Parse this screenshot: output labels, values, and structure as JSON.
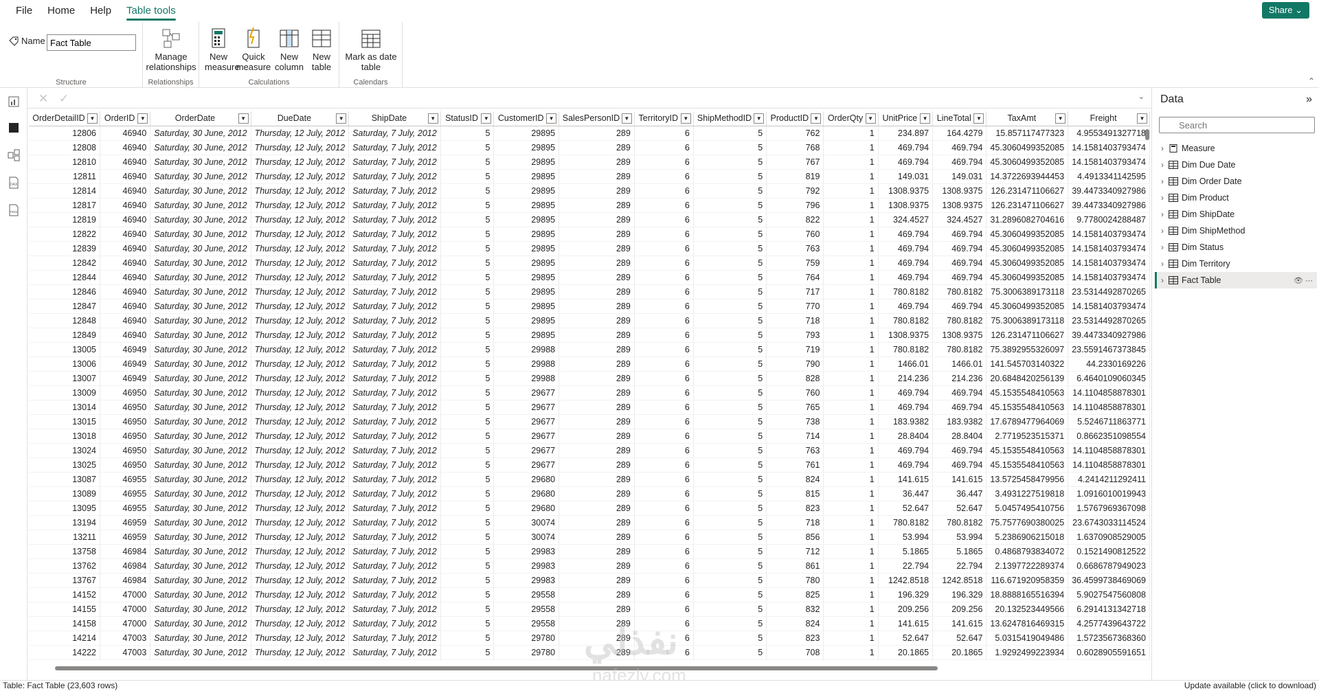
{
  "menu": [
    "File",
    "Home",
    "Help",
    "Table tools"
  ],
  "share_label": "Share",
  "ribbon": {
    "name_label": "Name",
    "name_value": "Fact Table",
    "structure_label": "Structure",
    "manage_relationships": "Manage relationships",
    "relationships_label": "Relationships",
    "new_measure": "New measure",
    "quick_measure": "Quick measure",
    "new_column": "New column",
    "new_table": "New table",
    "calculations_label": "Calculations",
    "mark_as_date_table": "Mark as date table",
    "calendars_label": "Calendars"
  },
  "columns": [
    "OrderDetailID",
    "OrderID",
    "OrderDate",
    "DueDate",
    "ShipDate",
    "StatusID",
    "CustomerID",
    "SalesPersonID",
    "TerritoryID",
    "ShipMethodID",
    "ProductID",
    "OrderQty",
    "UnitPrice",
    "LineTotal",
    "TaxAmt",
    "Freight"
  ],
  "rows": [
    [
      "12806",
      "46940",
      "Saturday, 30 June, 2012",
      "Thursday, 12 July, 2012",
      "Saturday, 7 July, 2012",
      "5",
      "29895",
      "289",
      "6",
      "5",
      "762",
      "1",
      "234.897",
      "164.4279",
      "15.857117477323",
      "4.9553491327718"
    ],
    [
      "12808",
      "46940",
      "Saturday, 30 June, 2012",
      "Thursday, 12 July, 2012",
      "Saturday, 7 July, 2012",
      "5",
      "29895",
      "289",
      "6",
      "5",
      "768",
      "1",
      "469.794",
      "469.794",
      "45.3060499352085",
      "14.1581403793474"
    ],
    [
      "12810",
      "46940",
      "Saturday, 30 June, 2012",
      "Thursday, 12 July, 2012",
      "Saturday, 7 July, 2012",
      "5",
      "29895",
      "289",
      "6",
      "5",
      "767",
      "1",
      "469.794",
      "469.794",
      "45.3060499352085",
      "14.1581403793474"
    ],
    [
      "12811",
      "46940",
      "Saturday, 30 June, 2012",
      "Thursday, 12 July, 2012",
      "Saturday, 7 July, 2012",
      "5",
      "29895",
      "289",
      "6",
      "5",
      "819",
      "1",
      "149.031",
      "149.031",
      "14.3722693944453",
      "4.4913341142595"
    ],
    [
      "12814",
      "46940",
      "Saturday, 30 June, 2012",
      "Thursday, 12 July, 2012",
      "Saturday, 7 July, 2012",
      "5",
      "29895",
      "289",
      "6",
      "5",
      "792",
      "1",
      "1308.9375",
      "1308.9375",
      "126.231471106627",
      "39.4473340927986"
    ],
    [
      "12817",
      "46940",
      "Saturday, 30 June, 2012",
      "Thursday, 12 July, 2012",
      "Saturday, 7 July, 2012",
      "5",
      "29895",
      "289",
      "6",
      "5",
      "796",
      "1",
      "1308.9375",
      "1308.9375",
      "126.231471106627",
      "39.4473340927986"
    ],
    [
      "12819",
      "46940",
      "Saturday, 30 June, 2012",
      "Thursday, 12 July, 2012",
      "Saturday, 7 July, 2012",
      "5",
      "29895",
      "289",
      "6",
      "5",
      "822",
      "1",
      "324.4527",
      "324.4527",
      "31.2896082704616",
      "9.7780024288487"
    ],
    [
      "12822",
      "46940",
      "Saturday, 30 June, 2012",
      "Thursday, 12 July, 2012",
      "Saturday, 7 July, 2012",
      "5",
      "29895",
      "289",
      "6",
      "5",
      "760",
      "1",
      "469.794",
      "469.794",
      "45.3060499352085",
      "14.1581403793474"
    ],
    [
      "12839",
      "46940",
      "Saturday, 30 June, 2012",
      "Thursday, 12 July, 2012",
      "Saturday, 7 July, 2012",
      "5",
      "29895",
      "289",
      "6",
      "5",
      "763",
      "1",
      "469.794",
      "469.794",
      "45.3060499352085",
      "14.1581403793474"
    ],
    [
      "12842",
      "46940",
      "Saturday, 30 June, 2012",
      "Thursday, 12 July, 2012",
      "Saturday, 7 July, 2012",
      "5",
      "29895",
      "289",
      "6",
      "5",
      "759",
      "1",
      "469.794",
      "469.794",
      "45.3060499352085",
      "14.1581403793474"
    ],
    [
      "12844",
      "46940",
      "Saturday, 30 June, 2012",
      "Thursday, 12 July, 2012",
      "Saturday, 7 July, 2012",
      "5",
      "29895",
      "289",
      "6",
      "5",
      "764",
      "1",
      "469.794",
      "469.794",
      "45.3060499352085",
      "14.1581403793474"
    ],
    [
      "12846",
      "46940",
      "Saturday, 30 June, 2012",
      "Thursday, 12 July, 2012",
      "Saturday, 7 July, 2012",
      "5",
      "29895",
      "289",
      "6",
      "5",
      "717",
      "1",
      "780.8182",
      "780.8182",
      "75.3006389173118",
      "23.5314492870265"
    ],
    [
      "12847",
      "46940",
      "Saturday, 30 June, 2012",
      "Thursday, 12 July, 2012",
      "Saturday, 7 July, 2012",
      "5",
      "29895",
      "289",
      "6",
      "5",
      "770",
      "1",
      "469.794",
      "469.794",
      "45.3060499352085",
      "14.1581403793474"
    ],
    [
      "12848",
      "46940",
      "Saturday, 30 June, 2012",
      "Thursday, 12 July, 2012",
      "Saturday, 7 July, 2012",
      "5",
      "29895",
      "289",
      "6",
      "5",
      "718",
      "1",
      "780.8182",
      "780.8182",
      "75.3006389173118",
      "23.5314492870265"
    ],
    [
      "12849",
      "46940",
      "Saturday, 30 June, 2012",
      "Thursday, 12 July, 2012",
      "Saturday, 7 July, 2012",
      "5",
      "29895",
      "289",
      "6",
      "5",
      "793",
      "1",
      "1308.9375",
      "1308.9375",
      "126.231471106627",
      "39.4473340927986"
    ],
    [
      "13005",
      "46949",
      "Saturday, 30 June, 2012",
      "Thursday, 12 July, 2012",
      "Saturday, 7 July, 2012",
      "5",
      "29988",
      "289",
      "6",
      "5",
      "719",
      "1",
      "780.8182",
      "780.8182",
      "75.3892955326097",
      "23.5591467373845"
    ],
    [
      "13006",
      "46949",
      "Saturday, 30 June, 2012",
      "Thursday, 12 July, 2012",
      "Saturday, 7 July, 2012",
      "5",
      "29988",
      "289",
      "6",
      "5",
      "790",
      "1",
      "1466.01",
      "1466.01",
      "141.545703140322",
      "44.2330169226"
    ],
    [
      "13007",
      "46949",
      "Saturday, 30 June, 2012",
      "Thursday, 12 July, 2012",
      "Saturday, 7 July, 2012",
      "5",
      "29988",
      "289",
      "6",
      "5",
      "828",
      "1",
      "214.236",
      "214.236",
      "20.6848420256139",
      "6.4640109060345"
    ],
    [
      "13009",
      "46950",
      "Saturday, 30 June, 2012",
      "Thursday, 12 July, 2012",
      "Saturday, 7 July, 2012",
      "5",
      "29677",
      "289",
      "6",
      "5",
      "760",
      "1",
      "469.794",
      "469.794",
      "45.1535548410563",
      "14.1104858878301"
    ],
    [
      "13014",
      "46950",
      "Saturday, 30 June, 2012",
      "Thursday, 12 July, 2012",
      "Saturday, 7 July, 2012",
      "5",
      "29677",
      "289",
      "6",
      "5",
      "765",
      "1",
      "469.794",
      "469.794",
      "45.1535548410563",
      "14.1104858878301"
    ],
    [
      "13015",
      "46950",
      "Saturday, 30 June, 2012",
      "Thursday, 12 July, 2012",
      "Saturday, 7 July, 2012",
      "5",
      "29677",
      "289",
      "6",
      "5",
      "738",
      "1",
      "183.9382",
      "183.9382",
      "17.6789477964069",
      "5.5246711863771"
    ],
    [
      "13018",
      "46950",
      "Saturday, 30 June, 2012",
      "Thursday, 12 July, 2012",
      "Saturday, 7 July, 2012",
      "5",
      "29677",
      "289",
      "6",
      "5",
      "714",
      "1",
      "28.8404",
      "28.8404",
      "2.7719523515371",
      "0.8662351098554"
    ],
    [
      "13024",
      "46950",
      "Saturday, 30 June, 2012",
      "Thursday, 12 July, 2012",
      "Saturday, 7 July, 2012",
      "5",
      "29677",
      "289",
      "6",
      "5",
      "763",
      "1",
      "469.794",
      "469.794",
      "45.1535548410563",
      "14.1104858878301"
    ],
    [
      "13025",
      "46950",
      "Saturday, 30 June, 2012",
      "Thursday, 12 July, 2012",
      "Saturday, 7 July, 2012",
      "5",
      "29677",
      "289",
      "6",
      "5",
      "761",
      "1",
      "469.794",
      "469.794",
      "45.1535548410563",
      "14.1104858878301"
    ],
    [
      "13087",
      "46955",
      "Saturday, 30 June, 2012",
      "Thursday, 12 July, 2012",
      "Saturday, 7 July, 2012",
      "5",
      "29680",
      "289",
      "6",
      "5",
      "824",
      "1",
      "141.615",
      "141.615",
      "13.5725458479956",
      "4.2414211292411"
    ],
    [
      "13089",
      "46955",
      "Saturday, 30 June, 2012",
      "Thursday, 12 July, 2012",
      "Saturday, 7 July, 2012",
      "5",
      "29680",
      "289",
      "6",
      "5",
      "815",
      "1",
      "36.447",
      "36.447",
      "3.4931227519818",
      "1.0916010019943"
    ],
    [
      "13095",
      "46955",
      "Saturday, 30 June, 2012",
      "Thursday, 12 July, 2012",
      "Saturday, 7 July, 2012",
      "5",
      "29680",
      "289",
      "6",
      "5",
      "823",
      "1",
      "52.647",
      "52.647",
      "5.0457495410756",
      "1.5767969367098"
    ],
    [
      "13194",
      "46959",
      "Saturday, 30 June, 2012",
      "Thursday, 12 July, 2012",
      "Saturday, 7 July, 2012",
      "5",
      "30074",
      "289",
      "6",
      "5",
      "718",
      "1",
      "780.8182",
      "780.8182",
      "75.7577690380025",
      "23.6743033114524"
    ],
    [
      "13211",
      "46959",
      "Saturday, 30 June, 2012",
      "Thursday, 12 July, 2012",
      "Saturday, 7 July, 2012",
      "5",
      "30074",
      "289",
      "6",
      "5",
      "856",
      "1",
      "53.994",
      "53.994",
      "5.2386906215018",
      "1.6370908529005"
    ],
    [
      "13758",
      "46984",
      "Saturday, 30 June, 2012",
      "Thursday, 12 July, 2012",
      "Saturday, 7 July, 2012",
      "5",
      "29983",
      "289",
      "6",
      "5",
      "712",
      "1",
      "5.1865",
      "5.1865",
      "0.4868793834072",
      "0.1521490812522"
    ],
    [
      "13762",
      "46984",
      "Saturday, 30 June, 2012",
      "Thursday, 12 July, 2012",
      "Saturday, 7 July, 2012",
      "5",
      "29983",
      "289",
      "6",
      "5",
      "861",
      "1",
      "22.794",
      "22.794",
      "2.1397722289374",
      "0.6686787949023"
    ],
    [
      "13767",
      "46984",
      "Saturday, 30 June, 2012",
      "Thursday, 12 July, 2012",
      "Saturday, 7 July, 2012",
      "5",
      "29983",
      "289",
      "6",
      "5",
      "780",
      "1",
      "1242.8518",
      "1242.8518",
      "116.671920958359",
      "36.4599738469069"
    ],
    [
      "14152",
      "47000",
      "Saturday, 30 June, 2012",
      "Thursday, 12 July, 2012",
      "Saturday, 7 July, 2012",
      "5",
      "29558",
      "289",
      "6",
      "5",
      "825",
      "1",
      "196.329",
      "196.329",
      "18.8888165516394",
      "5.9027547560808"
    ],
    [
      "14155",
      "47000",
      "Saturday, 30 June, 2012",
      "Thursday, 12 July, 2012",
      "Saturday, 7 July, 2012",
      "5",
      "29558",
      "289",
      "6",
      "5",
      "832",
      "1",
      "209.256",
      "209.256",
      "20.132523449566",
      "6.2914131342718"
    ],
    [
      "14158",
      "47000",
      "Saturday, 30 June, 2012",
      "Thursday, 12 July, 2012",
      "Saturday, 7 July, 2012",
      "5",
      "29558",
      "289",
      "6",
      "5",
      "824",
      "1",
      "141.615",
      "141.615",
      "13.6247816469315",
      "4.2577439643722"
    ],
    [
      "14214",
      "47003",
      "Saturday, 30 June, 2012",
      "Thursday, 12 July, 2012",
      "Saturday, 7 July, 2012",
      "5",
      "29780",
      "289",
      "6",
      "5",
      "823",
      "1",
      "52.647",
      "52.647",
      "5.0315419049486",
      "1.5723567368360"
    ],
    [
      "14222",
      "47003",
      "Saturday, 30 June, 2012",
      "Thursday, 12 July, 2012",
      "Saturday, 7 July, 2012",
      "5",
      "29780",
      "289",
      "6",
      "5",
      "708",
      "1",
      "20.1865",
      "20.1865",
      "1.9292499223934",
      "0.6028905591651"
    ]
  ],
  "data_pane": {
    "title": "Data",
    "search_placeholder": "Search",
    "items": [
      "Measure",
      "Dim Due Date",
      "Dim Order Date",
      "Dim Product",
      "Dim ShipDate",
      "Dim ShipMethod",
      "Dim Status",
      "Dim Territory",
      "Fact Table"
    ],
    "selected": "Fact Table"
  },
  "status": {
    "left": "Table: Fact Table (23,603 rows)",
    "right": "Update available (click to download)"
  },
  "watermark": {
    "arabic": "نفذلي",
    "latin": "nafezly.com"
  },
  "colors": {
    "accent": "#117865"
  }
}
